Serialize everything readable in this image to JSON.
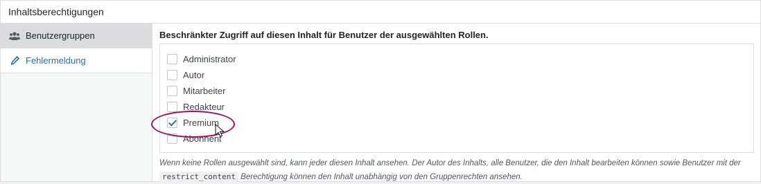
{
  "panel": {
    "title": "Inhaltsberechtigungen"
  },
  "tabs": [
    {
      "label": "Benutzergruppen",
      "icon": "users-icon",
      "active": true
    },
    {
      "label": "Fehlermeldung",
      "icon": "pencil-icon",
      "active": false
    }
  ],
  "content": {
    "description": "Beschränkter Zugriff auf diesen Inhalt für Benutzer der ausgewählten Rollen.",
    "roles": [
      {
        "label": "Administrator",
        "checked": false
      },
      {
        "label": "Autor",
        "checked": false
      },
      {
        "label": "Mitarbeiter",
        "checked": false
      },
      {
        "label": "Redakteur",
        "checked": false
      },
      {
        "label": "Premium",
        "checked": true
      },
      {
        "label": "Abonnent",
        "checked": false
      }
    ],
    "note_part1": "Wenn keine Rollen ausgewählt sind, kann jeder diesen Inhalt ansehen. Der Autor des Inhalts, alle Benutzer, die den Inhalt bearbeiten können sowie Benutzer mit der",
    "note_code": "restrict_content",
    "note_part2": "Berechtigung können den Inhalt unabhängig von den Gruppenrechten ansehen."
  },
  "colors": {
    "link": "#2271b1",
    "highlight": "#a00f5a"
  }
}
